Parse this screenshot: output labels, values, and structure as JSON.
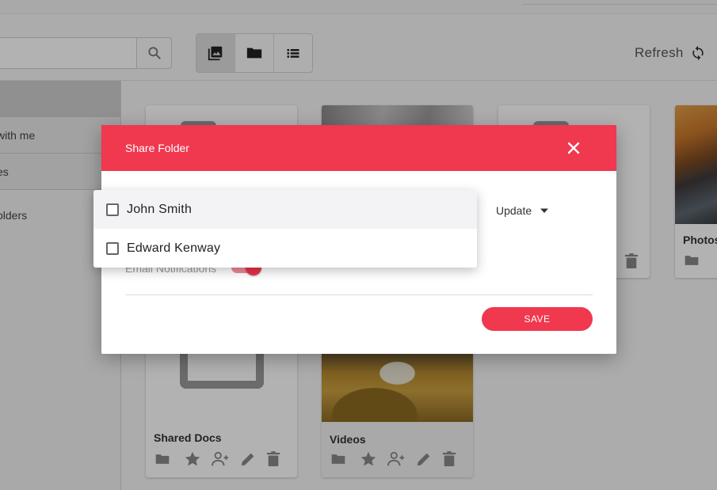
{
  "toolbar": {
    "search_placeholder": "",
    "refresh_label": "Refresh"
  },
  "sidebar": {
    "items": [
      {
        "label": "with me"
      },
      {
        "label": "es"
      },
      {
        "label": "olders"
      }
    ]
  },
  "cards": [
    {
      "title": "Shared Docs"
    },
    {
      "title": "Videos"
    },
    {
      "title": "Photos"
    }
  ],
  "modal": {
    "title": "Share Folder",
    "permission_value": "Update",
    "email_notifications_label": "Email Notifications",
    "email_notifications_on": true,
    "save_label": "SAVE"
  },
  "dropdown": {
    "options": [
      {
        "label": "John Smith",
        "checked": false
      },
      {
        "label": "Edward Kenway",
        "checked": false
      }
    ]
  },
  "colors": {
    "accent": "#f0384f",
    "toggle_track": "#f08a98"
  },
  "icons": [
    "search-icon",
    "image-view-icon",
    "folder-view-icon",
    "list-view-icon",
    "refresh-icon",
    "close-icon",
    "caret-down-icon",
    "folder-icon",
    "star-icon",
    "add-person-icon",
    "edit-icon",
    "delete-icon"
  ]
}
